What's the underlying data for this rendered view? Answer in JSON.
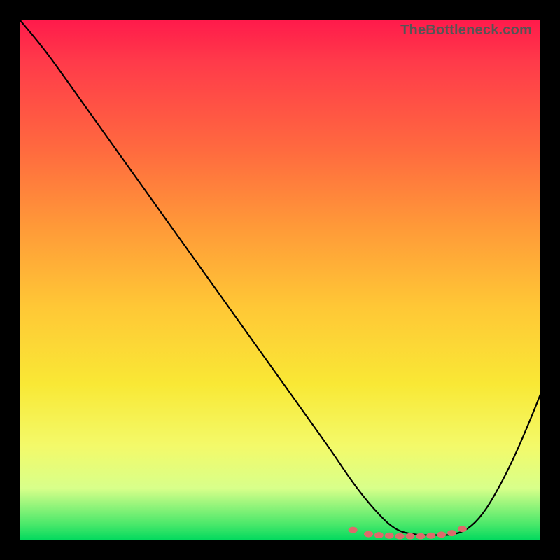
{
  "attribution": "TheBottleneck.com",
  "chart_data": {
    "type": "line",
    "title": "",
    "xlabel": "",
    "ylabel": "",
    "xlim": [
      0,
      100
    ],
    "ylim": [
      0,
      100
    ],
    "grid": false,
    "legend": false,
    "series": [
      {
        "name": "bottleneck-curve",
        "color": "#000000",
        "x": [
          0,
          5,
          10,
          15,
          20,
          25,
          30,
          35,
          40,
          45,
          50,
          55,
          60,
          64,
          68,
          72,
          76,
          80,
          83,
          86,
          89,
          92,
          95,
          98,
          100
        ],
        "values": [
          100,
          94,
          87,
          80,
          73,
          66,
          59,
          52,
          45,
          38,
          31,
          24,
          17,
          11,
          6,
          2,
          1,
          1,
          1,
          2,
          5,
          10,
          16,
          23,
          28
        ]
      },
      {
        "name": "optimal-zone-dots",
        "color": "#dd6b6b",
        "x": [
          64,
          67,
          69,
          71,
          73,
          75,
          77,
          79,
          81,
          83,
          85
        ],
        "values": [
          2,
          1.2,
          1,
          0.9,
          0.8,
          0.8,
          0.8,
          0.9,
          1.1,
          1.4,
          2.2
        ]
      }
    ],
    "gradient_stops": [
      {
        "pos": 0,
        "color": "#ff1a4b"
      },
      {
        "pos": 8,
        "color": "#ff3a4a"
      },
      {
        "pos": 25,
        "color": "#ff6a3f"
      },
      {
        "pos": 40,
        "color": "#ff9a38"
      },
      {
        "pos": 55,
        "color": "#ffc736"
      },
      {
        "pos": 70,
        "color": "#f9e835"
      },
      {
        "pos": 82,
        "color": "#f3fa6a"
      },
      {
        "pos": 90,
        "color": "#d8ff8a"
      },
      {
        "pos": 97,
        "color": "#48e86a"
      },
      {
        "pos": 100,
        "color": "#00d95e"
      }
    ]
  }
}
